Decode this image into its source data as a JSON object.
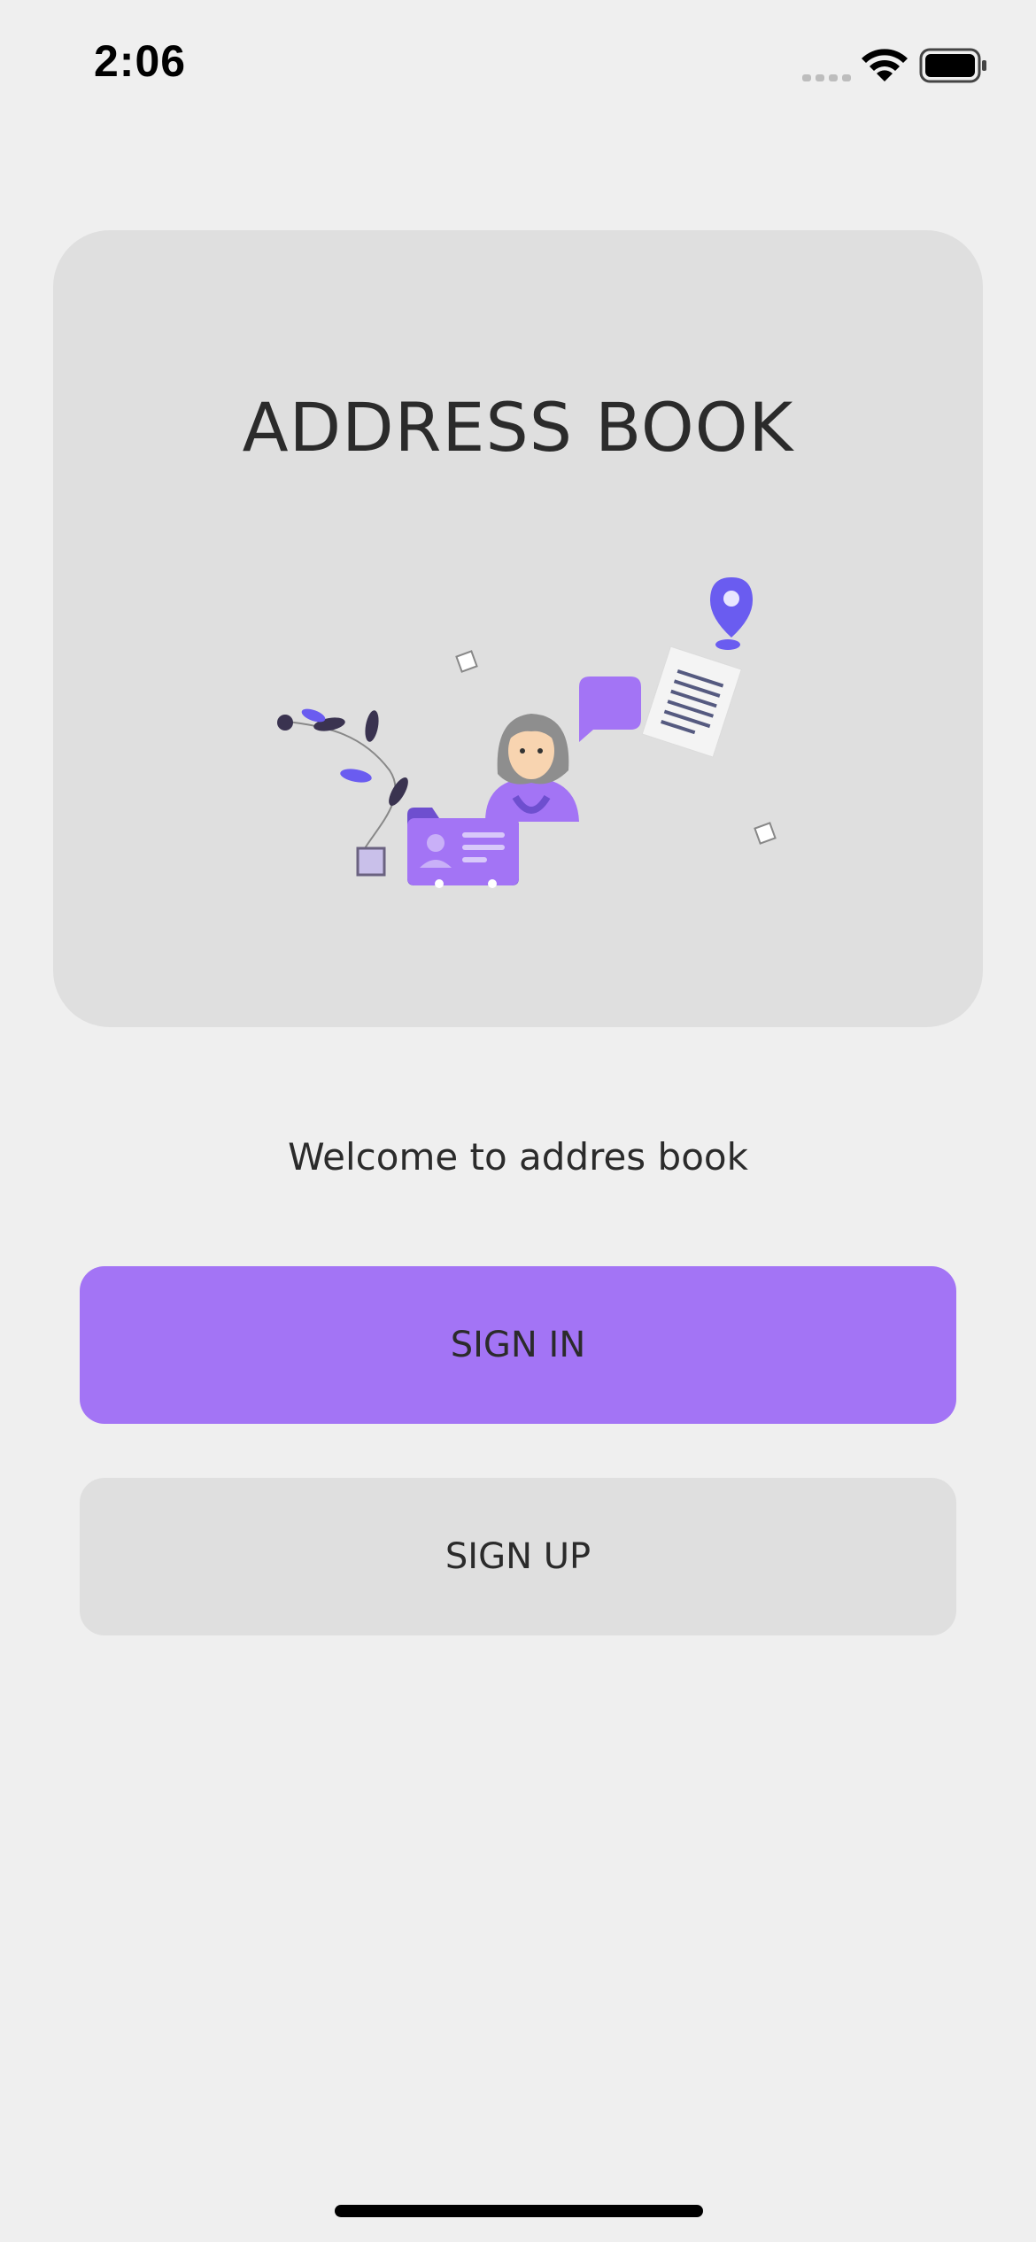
{
  "status_bar": {
    "time": "2:06"
  },
  "hero": {
    "title": "ADDRESS BOOK",
    "illustration_icon": "address-book-illustration"
  },
  "welcome": {
    "text": "Welcome to addres book"
  },
  "buttons": {
    "sign_in_label": "SIGN IN",
    "sign_up_label": "SIGN UP"
  },
  "colors": {
    "accent": "#a374f5",
    "background": "#efefef",
    "card": "#dfdfdf",
    "text": "#2b2b2b"
  }
}
